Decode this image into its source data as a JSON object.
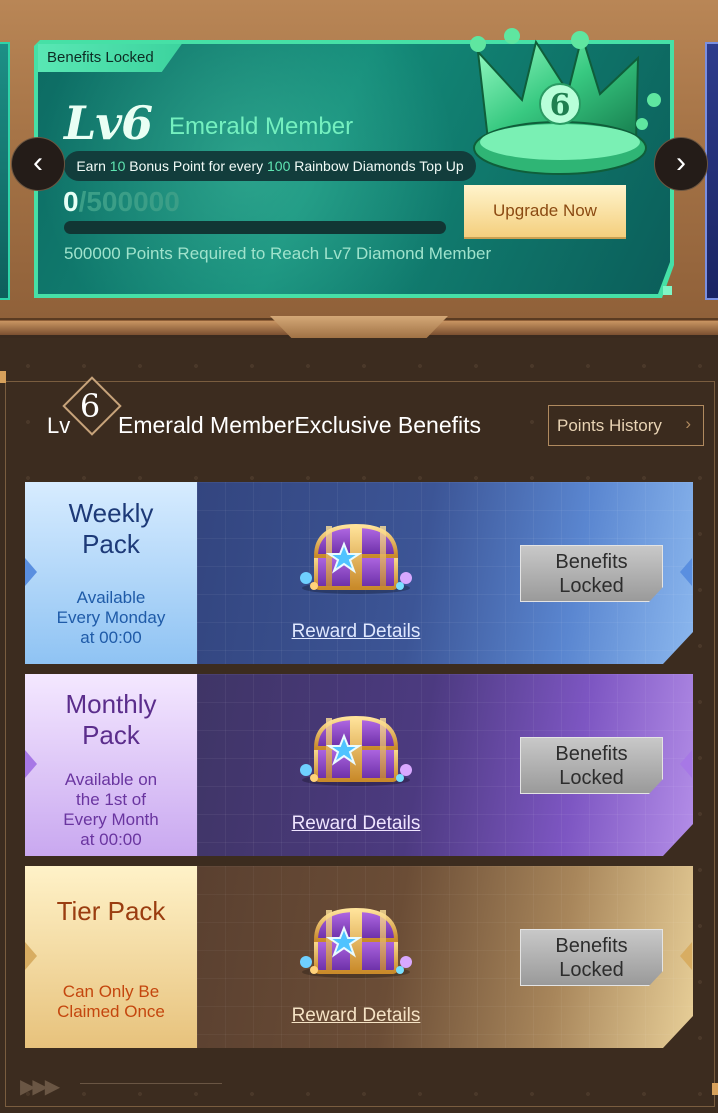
{
  "membership": {
    "locked_tag": "Benefits Locked",
    "level_label": "Lv6",
    "member_name": "Emerald Member",
    "earn_prefix": "Earn ",
    "earn_points": "10",
    "earn_middle": " Bonus Point for every ",
    "earn_diamonds": "100",
    "earn_suffix": " Rainbow Diamonds Top Up",
    "points_current": "0",
    "points_target": "/500000",
    "progress_fraction": 0,
    "requirement_text": "500000 Points Required to Reach Lv7 Diamond Member",
    "upgrade_label": "Upgrade Now",
    "crown_number": "6"
  },
  "nav": {
    "prev_icon": "‹",
    "next_icon": "›"
  },
  "benefits": {
    "lv_label": "Lv",
    "level_number": "6",
    "title": "Emerald MemberExclusive Benefits",
    "history_label": "Points History",
    "history_icon": "›"
  },
  "packs": [
    {
      "title_line1": "Weekly",
      "title_line2": "Pack",
      "sub_lines": [
        "Available",
        "Every Monday",
        "at 00:00"
      ],
      "reward_link": "Reward Details",
      "locked_line1": "Benefits",
      "locked_line2": "Locked"
    },
    {
      "title_line1": "Monthly",
      "title_line2": "Pack",
      "sub_lines": [
        "Available on",
        "the 1st of",
        "Every Month",
        "at 00:00"
      ],
      "reward_link": "Reward Details",
      "locked_line1": "Benefits",
      "locked_line2": "Locked"
    },
    {
      "title_line1": "Tier Pack",
      "title_line2": "",
      "sub_lines": [
        "Can Only Be",
        "Claimed Once"
      ],
      "reward_link": "Reward Details",
      "locked_line1": "Benefits",
      "locked_line2": "Locked"
    }
  ],
  "colors": {
    "emerald_accent": "#5fe6b2",
    "upgrade_text": "#8b4a12",
    "weekly_title": "#1d3a78",
    "monthly_title": "#5b2d8c",
    "tier_title": "#9a3d10"
  }
}
